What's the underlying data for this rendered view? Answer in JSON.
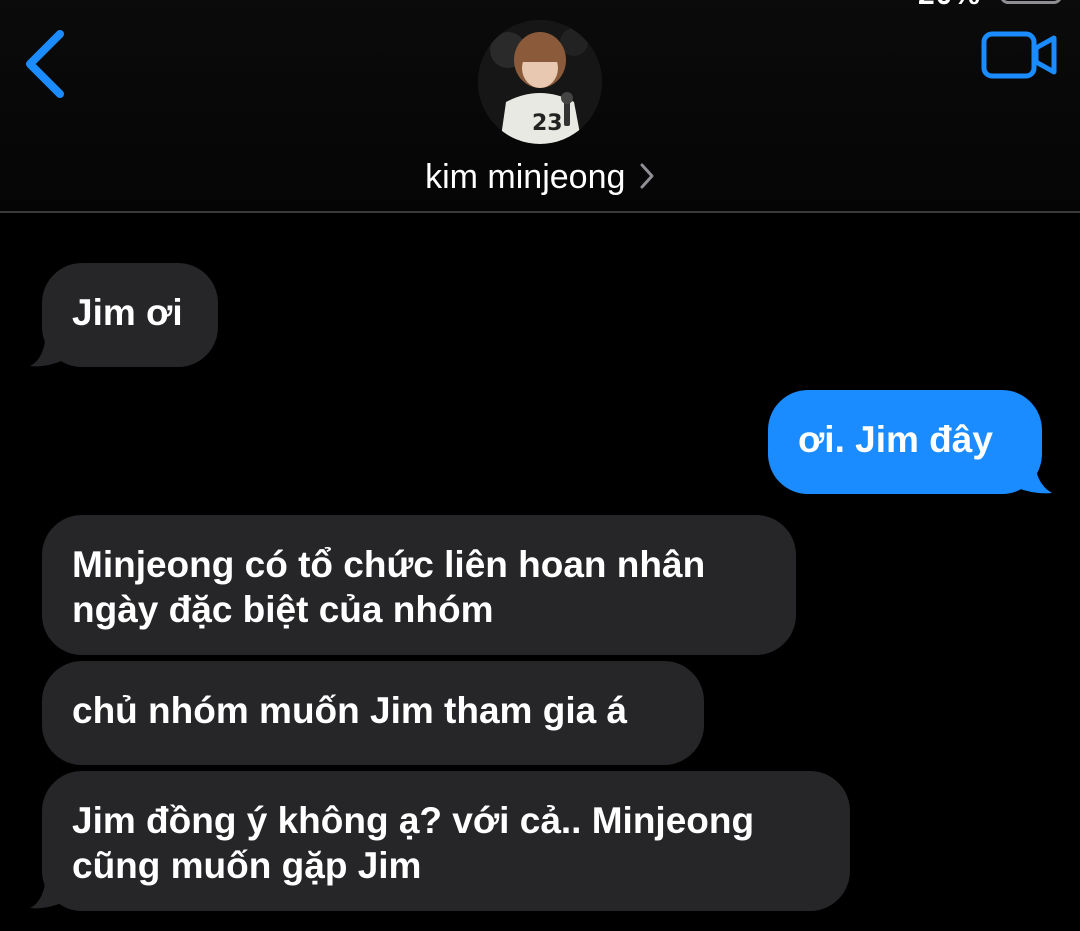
{
  "status_bar": {
    "battery_fragment": "20%"
  },
  "header": {
    "back_icon": "chevron-left-icon",
    "video_icon": "video-camera-icon",
    "contact_name": "kim minjeong",
    "contact_chevron_icon": "chevron-right-icon",
    "accent_color": "#1a8cff"
  },
  "messages": [
    {
      "sender": "them",
      "lines": [
        "Jim ơi"
      ]
    },
    {
      "sender": "me",
      "lines": [
        "ơi. Jim đây"
      ]
    },
    {
      "sender": "them",
      "lines": [
        "Minjeong có tổ chức liên hoan nhân",
        "ngày đặc biệt của nhóm"
      ]
    },
    {
      "sender": "them",
      "lines": [
        "chủ nhóm muốn Jim tham gia á"
      ]
    },
    {
      "sender": "them",
      "lines": [
        "Jim đồng ý không ạ? với cả.. Minjeong",
        "cũng muốn gặp Jim"
      ]
    }
  ],
  "colors": {
    "incoming_bubble": "#262629",
    "outgoing_bubble": "#1a8cff",
    "background": "#000000"
  }
}
